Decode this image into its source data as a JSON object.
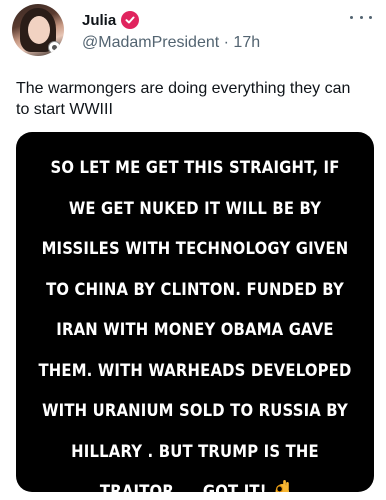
{
  "author": {
    "name": "Julia",
    "handle": "@MadamPresident",
    "separator": "·",
    "time": "17h",
    "verified_color": "#e0245e"
  },
  "tweet": {
    "text": "The warmongers are doing everything they can to start WWIII"
  },
  "media": {
    "lines": [
      "SO LET ME GET THIS STRAIGHT, IF",
      "WE GET NUKED IT WILL BE BY",
      "MISSILES WITH TECHNOLOGY GIVEN",
      "TO CHINA BY CLINTON. FUNDED BY",
      "IRAN WITH MONEY OBAMA GAVE",
      "THEM. WITH WARHEADS DEVELOPED",
      "WITH URANIUM SOLD TO RUSSIA BY",
      "HILLARY . BUT TRUMP IS THE",
      "TRAITOR.... GOT IT!"
    ],
    "emoji": "ok-hand-emoji"
  },
  "icons": {
    "more": "more-horizontal-icon",
    "verified": "verified-badge-icon"
  },
  "colors": {
    "text": "#0f1419",
    "secondary": "#536471",
    "media_background": "#000000"
  }
}
